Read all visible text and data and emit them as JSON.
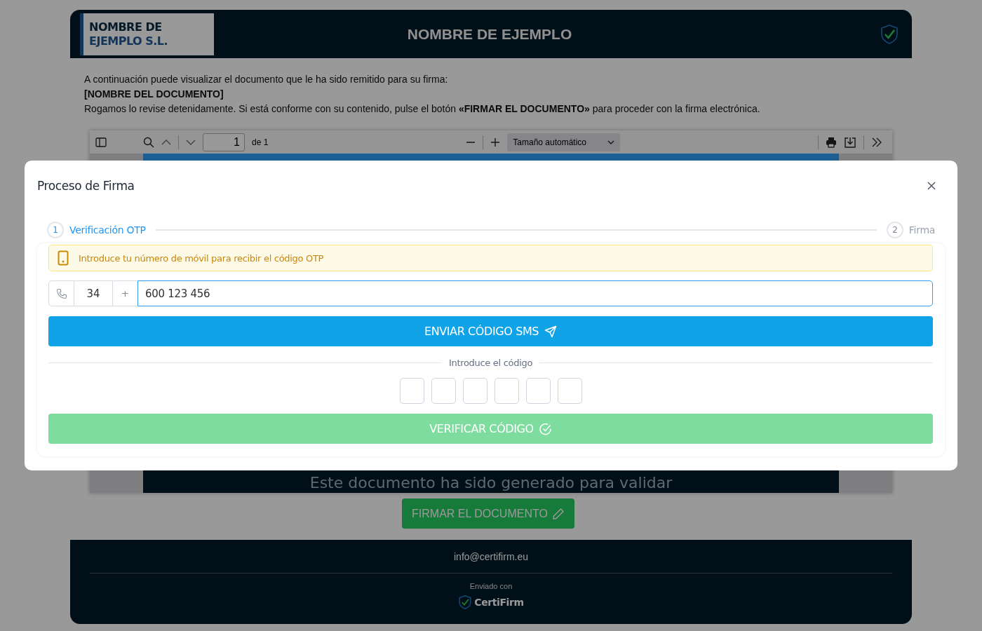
{
  "header": {
    "logo_lines": [
      "NOMBRE DE",
      "EJEMPLO S.L."
    ],
    "title": "NOMBRE DE EJEMPLO"
  },
  "intro": [
    {
      "kind": "plain",
      "text": "A continuación puede visualizar el documento que le ha sido remitido para su firma:"
    },
    {
      "kind": "bold",
      "text": "[NOMBRE DEL DOCUMENTO]"
    },
    {
      "kind": "plain",
      "text": "Rogamos lo revise detenidamente. Si está conforme con su contenido, pulse el botón **«FIRMAR EL DOCUMENTO»** para proceder con la firma electrónica."
    }
  ],
  "viewer": {
    "page_input": "1",
    "page_count": "de 1",
    "zoom": "Tamaño automático",
    "document_text": "Este documento ha sido generado para validar"
  },
  "sign_button": "FIRMAR EL DOCUMENTO",
  "footer": {
    "email": "info@certifirm.eu",
    "sent_with": "Enviado con",
    "brand": "CertiFirm"
  },
  "modal": {
    "title": "Proceso de Firma",
    "steps": [
      {
        "number": "1",
        "label": "Verificación OTP",
        "selected": true
      },
      {
        "number": "2",
        "label": "Firma",
        "selected": false
      }
    ],
    "notice": "Introduce tu número de móvil para recibir el código OTP",
    "phone": {
      "country_code": "34",
      "prefix": "+",
      "number": "600 123 456"
    },
    "send_button": "ENVIAR CÓDIGO SMS",
    "code_label": "Introduce el código",
    "code_boxes": [
      {
        "filled": false
      },
      {
        "filled": false
      },
      {
        "filled": false
      },
      {
        "filled": false
      },
      {
        "filled": false
      },
      {
        "filled": false
      }
    ],
    "verify_button": {
      "label": "VERIFICAR CÓDIGO",
      "disabled": true
    }
  }
}
